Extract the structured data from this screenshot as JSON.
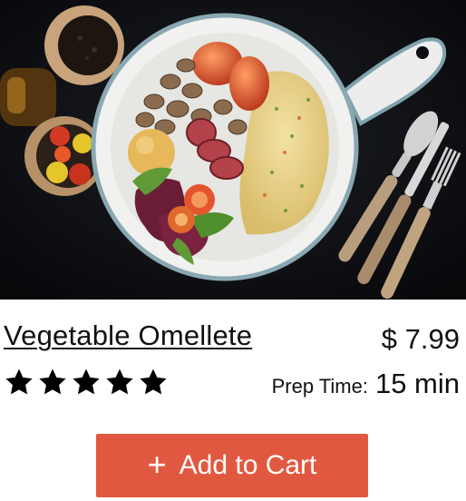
{
  "product": {
    "image_alt": "Omelette with roasted tomatoes, mushrooms, sausage and salad in a white skillet",
    "title": "Vegetable Omellete",
    "price": "$ 7.99",
    "rating": 5,
    "rating_max": 5,
    "prep_label": "Prep Time:",
    "prep_value": "15 min"
  },
  "actions": {
    "add_icon": "plus-icon",
    "add_to_cart_label": "Add to Cart"
  },
  "colors": {
    "button_bg": "#e15840",
    "star_fill": "#000000",
    "hero_bg": "#0c0d10"
  }
}
